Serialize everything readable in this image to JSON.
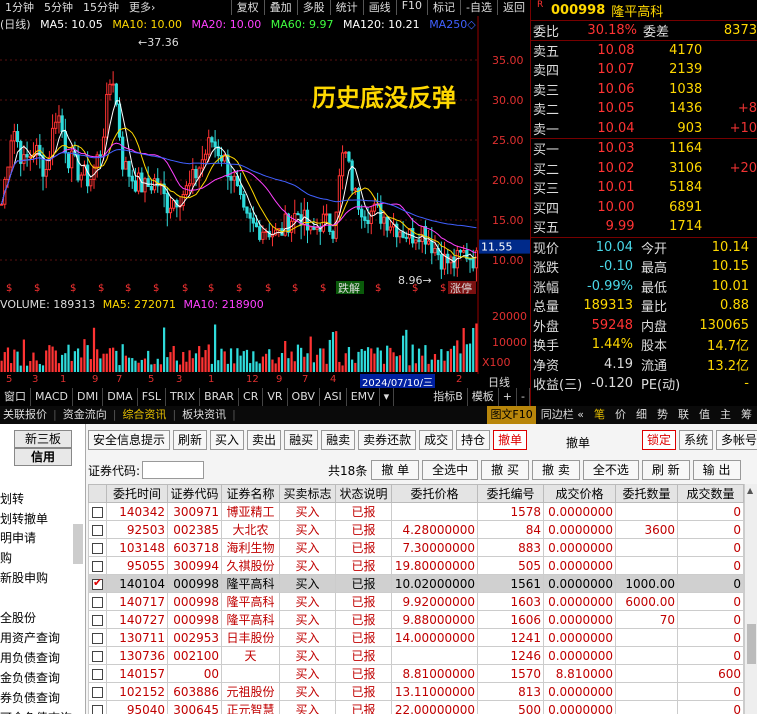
{
  "menubar": {
    "left": [
      "1分钟",
      "5分钟",
      "15分钟",
      "更多›"
    ],
    "right": [
      "复权",
      "叠加",
      "多股",
      "统计",
      "画线",
      "F10",
      "标记",
      "-自选",
      "返回"
    ]
  },
  "ma_legend": {
    "prefix": "(日线)",
    "ma5": "MA5: 10.05",
    "ma10": "MA10: 10.00",
    "ma20": "MA20: 10.00",
    "ma60": "MA60: 9.97",
    "ma120": "MA120: 10.21",
    "ma250": "MA250◇"
  },
  "overlay_text": "历史底没反弹",
  "price_axis": [
    "35.00",
    "30.00",
    "25.00",
    "20.00",
    "15.00",
    "10.00"
  ],
  "price_marker": "11.55",
  "high_label": "37.36",
  "low_label": "8.96",
  "chip_labels": {
    "left": "跌解",
    "right": "涨停"
  },
  "vol_legend": {
    "vol": "VOLUME: 189313",
    "ma5": "MA5: 272071",
    "ma10": "MA10: 218900"
  },
  "vol_axis": [
    "20000",
    "10000",
    "X100"
  ],
  "date_axis": {
    "items": [
      "5",
      "3",
      "1",
      "9",
      "7",
      "5",
      "3",
      "1",
      "12",
      "9",
      "7",
      "4",
      "2"
    ],
    "highlight": "2024/07/10/三",
    "unit": "日线"
  },
  "tabs_row1": [
    "窗口",
    "MACD",
    "DMI",
    "DMA",
    "FSL",
    "TRIX",
    "BRAR",
    "CR",
    "VR",
    "OBV",
    "ASI",
    "EMV",
    "▾",
    "指标B",
    "模板",
    "+",
    "-"
  ],
  "tabs_row2": {
    "left": [
      "关联报价",
      "资金流向",
      "综合资讯",
      "板块资讯"
    ],
    "highlight": "综合资讯",
    "right_hl": "图文F10",
    "right": [
      "同边栏 «",
      "笔",
      "价",
      "细",
      "势",
      "联",
      "值",
      "主",
      "筹"
    ]
  },
  "quote": {
    "code": "000998",
    "name": "隆平高科",
    "weibi_label": "委比",
    "weibi": "30.18%",
    "weicha_label": "委差",
    "weicha": "8373",
    "asks": [
      {
        "label": "卖五",
        "price": "10.08",
        "vol": "4170",
        "chg": ""
      },
      {
        "label": "卖四",
        "price": "10.07",
        "vol": "2139",
        "chg": ""
      },
      {
        "label": "卖三",
        "price": "10.06",
        "vol": "1038",
        "chg": ""
      },
      {
        "label": "卖二",
        "price": "10.05",
        "vol": "1436",
        "chg": "+8"
      },
      {
        "label": "卖一",
        "price": "10.04",
        "vol": "903",
        "chg": "+10"
      }
    ],
    "bids": [
      {
        "label": "买一",
        "price": "10.03",
        "vol": "1164",
        "chg": ""
      },
      {
        "label": "买二",
        "price": "10.02",
        "vol": "3106",
        "chg": "+20"
      },
      {
        "label": "买三",
        "price": "10.01",
        "vol": "5184",
        "chg": ""
      },
      {
        "label": "买四",
        "price": "10.00",
        "vol": "6891",
        "chg": ""
      },
      {
        "label": "买五",
        "price": "9.99",
        "vol": "1714",
        "chg": ""
      }
    ],
    "stats": [
      {
        "l1": "现价",
        "v1": "10.04",
        "l2": "今开",
        "v2": "10.14",
        "c1": "cyan",
        "c2": "white"
      },
      {
        "l1": "涨跌",
        "v1": "-0.10",
        "l2": "最高",
        "v2": "10.15",
        "c1": "cyan",
        "c2": "red"
      },
      {
        "l1": "涨幅",
        "v1": "-0.99%",
        "l2": "最低",
        "v2": "10.01",
        "c1": "cyan",
        "c2": "cyan"
      },
      {
        "l1": "总量",
        "v1": "189313",
        "l2": "量比",
        "v2": "0.88",
        "c1": "yellow",
        "c2": "white"
      },
      {
        "l1": "外盘",
        "v1": "59248",
        "l2": "内盘",
        "v2": "130065",
        "c1": "red",
        "c2": "white"
      },
      {
        "l1": "换手",
        "v1": "1.44%",
        "l2": "股本",
        "v2": "14.7亿",
        "c1": "yellow",
        "c2": "white"
      },
      {
        "l1": "净资",
        "v1": "4.19",
        "l2": "流通",
        "v2": "13.2亿",
        "c1": "white",
        "c2": "white"
      },
      {
        "l1": "收益(三)",
        "v1": "-0.120",
        "l2": "PE(动)",
        "v2": "-",
        "c1": "white",
        "c2": "white"
      }
    ]
  },
  "left_nav": {
    "btn1": "新三板",
    "btn2": "信用",
    "items": [
      "划转",
      "划转撤单",
      "明申请",
      "购",
      "新股申购",
      "",
      "全股份",
      "用资产查询",
      "用负债查询",
      "金负债查询",
      "券负债查询",
      "可金负债查询"
    ]
  },
  "toolbar": {
    "buttons": [
      "安全信息提示",
      "刷新",
      "买入",
      "卖出",
      "融买",
      "融卖",
      "卖券还款",
      "成交",
      "持仓",
      "撤单"
    ],
    "title": "撤单",
    "right": [
      "锁定",
      "系统",
      "多帐号"
    ]
  },
  "filter": {
    "code_label": "证券代码:",
    "count": "共18条",
    "buttons": [
      "撤 单",
      "全选中",
      "撤 买",
      "撤 卖",
      "全不选",
      "刷 新",
      "输 出"
    ]
  },
  "grid": {
    "headers": [
      "",
      "委托时间",
      "证券代码",
      "证券名称",
      "买卖标志",
      "状态说明",
      "委托价格",
      "委托编号",
      "成交价格",
      "委托数量",
      "成交数量"
    ],
    "rows": [
      {
        "checked": false,
        "time": "140342",
        "code": "300971",
        "name": "博亚精工",
        "side": "买入",
        "status": "已报",
        "price": "",
        "no": "1578",
        "deal": "0.0000000",
        "qty": "",
        "done": "0"
      },
      {
        "checked": false,
        "time": "92503",
        "code": "002385",
        "name": "大北农",
        "side": "买入",
        "status": "已报",
        "price": "4.28000000",
        "no": "84",
        "deal": "0.0000000",
        "qty": "3600",
        "done": "0"
      },
      {
        "checked": false,
        "time": "103148",
        "code": "603718",
        "name": "海利生物",
        "side": "买入",
        "status": "已报",
        "price": "7.30000000",
        "no": "883",
        "deal": "0.0000000",
        "qty": "",
        "done": "0"
      },
      {
        "checked": false,
        "time": "95055",
        "code": "300994",
        "name": "久祺股份",
        "side": "买入",
        "status": "已报",
        "price": "19.80000000",
        "no": "505",
        "deal": "0.0000000",
        "qty": "",
        "done": "0"
      },
      {
        "checked": true,
        "time": "140104",
        "code": "000998",
        "name": "隆平高科",
        "side": "买入",
        "status": "已报",
        "price": "10.02000000",
        "no": "1561",
        "deal": "0.0000000",
        "qty": "1000.00",
        "done": "0"
      },
      {
        "checked": false,
        "time": "140717",
        "code": "000998",
        "name": "隆平高科",
        "side": "买入",
        "status": "已报",
        "price": "9.92000000",
        "no": "1603",
        "deal": "0.0000000",
        "qty": "6000.00",
        "done": "0"
      },
      {
        "checked": false,
        "time": "140727",
        "code": "000998",
        "name": "隆平高科",
        "side": "买入",
        "status": "已报",
        "price": "9.88000000",
        "no": "1606",
        "deal": "0.0000000",
        "qty": "70",
        "done": "0"
      },
      {
        "checked": false,
        "time": "130711",
        "code": "002953",
        "name": "日丰股份",
        "side": "买入",
        "status": "已报",
        "price": "14.00000000",
        "no": "1241",
        "deal": "0.0000000",
        "qty": "",
        "done": "0"
      },
      {
        "checked": false,
        "time": "130736",
        "code": "002100",
        "name": "天",
        "side": "买入",
        "status": "已报",
        "price": "",
        "no": "1246",
        "deal": "0.0000000",
        "qty": "",
        "done": "0"
      },
      {
        "checked": false,
        "time": "140157",
        "code": "00",
        "name": "",
        "side": "买入",
        "status": "已报",
        "price": "8.81000000",
        "no": "1570",
        "deal": "8.810000",
        "qty": "",
        "done": "600"
      },
      {
        "checked": false,
        "time": "102152",
        "code": "603886",
        "name": "元祖股份",
        "side": "买入",
        "status": "已报",
        "price": "13.11000000",
        "no": "813",
        "deal": "0.0000000",
        "qty": "",
        "done": "0"
      },
      {
        "checked": false,
        "time": "95040",
        "code": "300645",
        "name": "正元智慧",
        "side": "买入",
        "status": "已报",
        "price": "22.00000000",
        "no": "500",
        "deal": "0.0000000",
        "qty": "",
        "done": "0"
      }
    ]
  },
  "colors": {
    "up": "#ff3333",
    "down": "#2fdc2f",
    "ma5": "#ffffff",
    "ma10": "#ffd800",
    "ma20": "#ff40ff",
    "ma60": "#40ff40",
    "ma120": "#ffffff",
    "ma250": "#4060ff"
  }
}
